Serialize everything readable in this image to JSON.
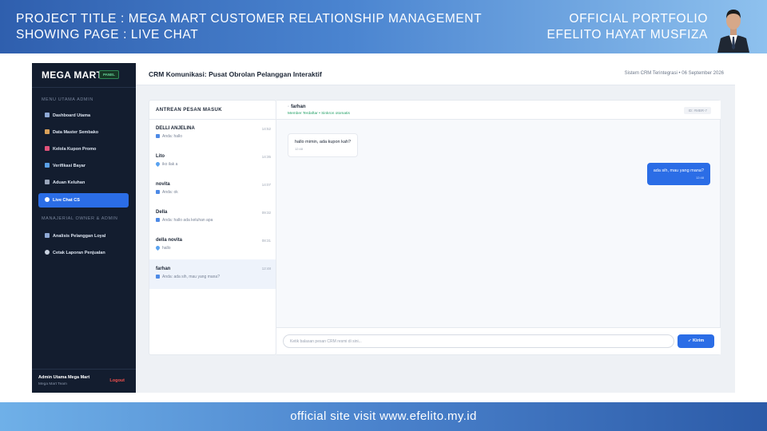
{
  "banner": {
    "project_title": "PROJECT TITLE  : MEGA MART CUSTOMER RELATIONSHIP MANAGEMENT",
    "showing_page": "SHOWING PAGE : LIVE CHAT",
    "portfolio": "OFFICIAL PORTFOLIO",
    "author": "EFELITO HAYAT MUSFIZA"
  },
  "footer": {
    "text": "official site visit www.efelito.my.id"
  },
  "sidebar": {
    "brand": "MEGA MART",
    "badge": "PANEL",
    "section_main": "MENU UTAMA ADMIN",
    "items_main": [
      {
        "label": "Dashboard Utama",
        "icon": "chart-icon"
      },
      {
        "label": "Data Master Sembako",
        "icon": "box-icon"
      },
      {
        "label": "Kelola Kupon Promo",
        "icon": "ticket-icon"
      },
      {
        "label": "Verifikasi Bayar",
        "icon": "card-icon"
      },
      {
        "label": "Aduan Keluhan",
        "icon": "inbox-icon"
      },
      {
        "label": "Live Chat CS",
        "icon": "chat-icon",
        "active": true
      }
    ],
    "section_owner": "MANAJERIAL OWNER & ADMIN",
    "items_owner": [
      {
        "label": "Analisis Pelanggan Loyal",
        "icon": "chart-icon"
      },
      {
        "label": "Cetak Laporan Penjualan",
        "icon": "print-icon"
      }
    ],
    "user_name": "Admin Utama Mega Mart",
    "user_team": "Mega Mart Team",
    "logout": "Logout"
  },
  "topbar": {
    "title": "CRM Komunikasi: Pusat Obrolan Pelanggan Interaktif",
    "meta": "Sistem CRM Terintegrasi • 06 September 2026"
  },
  "queue": {
    "header": "ANTREAN PESAN MASUK",
    "items": [
      {
        "name": "DELLI ANJELINA",
        "time": "14:52",
        "preview": "Anda: hallo"
      },
      {
        "name": "Lito",
        "time": "14:35",
        "preview": "iko ilak a"
      },
      {
        "name": "novita",
        "time": "14:07",
        "preview": "Anda: ok"
      },
      {
        "name": "Della",
        "time": "09:32",
        "preview": "Anda: hallo ada keluhan apa"
      },
      {
        "name": "della novita",
        "time": "08:31",
        "preview": "hallo"
      },
      {
        "name": "farhan",
        "time": "12:48",
        "preview": "Anda: ada sih, mau yang mana?"
      }
    ]
  },
  "chat": {
    "contact_name": "farhan",
    "status": "Member Terdaftar • Sinkron otomatis",
    "conversation_id": "ID: #MBR-7",
    "messages": [
      {
        "from": "customer",
        "text": "hallo mimin, ada kupon kah?",
        "time": "12:48"
      },
      {
        "from": "admin",
        "text": "ada sih, mau yang mana?",
        "time": "12:48"
      }
    ],
    "input_placeholder": "Ketik balasan pesan CRM resmi di sini...",
    "send_label": "Kirim"
  },
  "colors": {
    "accent": "#2b6de6",
    "sidebar_bg": "#131d2f",
    "logout": "#f0504d",
    "online": "#22a066"
  }
}
